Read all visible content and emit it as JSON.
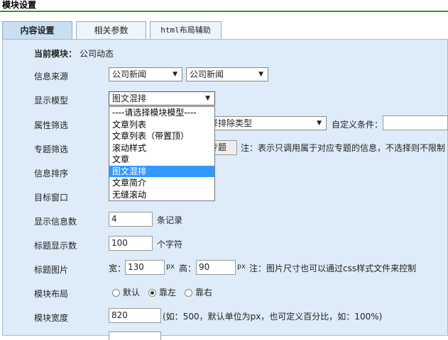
{
  "page_title": "模块设置",
  "tabs": [
    {
      "label": "内容设置",
      "active": true
    },
    {
      "label": "相关参数",
      "active": false
    },
    {
      "label": "html布局辅助",
      "active": false
    }
  ],
  "current_module": {
    "label": "当前模块：",
    "value": "公司动态"
  },
  "info_source": {
    "label": "信息来源",
    "select1": "公司新闻",
    "select2": "公司新闻"
  },
  "display_model": {
    "label": "显示模型",
    "selected": "图文混排",
    "options": [
      "----请选择模块模型----",
      "文章列表",
      "文章列表（带置顶）",
      "滚动样式",
      "文章",
      "图文混排",
      "文章简介",
      "无缝滚动"
    ],
    "selected_index": 5
  },
  "attr_filter": {
    "label": "属性筛选",
    "select_text": "择排除类型",
    "custom_label": "自定义条件："
  },
  "topic_filter": {
    "label": "专题筛选",
    "button_tail": "专题",
    "note": "注：表示只调用属于对应专题的信息，不选择则不限制"
  },
  "info_sort": {
    "label": "信息排序"
  },
  "target_window": {
    "label": "目标窗口"
  },
  "display_count": {
    "label": "显示信息数",
    "value": "4",
    "unit": "条记录"
  },
  "title_chars": {
    "label": "标题显示数",
    "value": "100",
    "unit": "个字符"
  },
  "title_image": {
    "label": "标题图片",
    "width_label": "宽：",
    "width": "130",
    "px1": "px",
    "height_label": "高：",
    "height": "90",
    "px2": "px",
    "note": "注：图片尺寸也可以通过css样式文件来控制"
  },
  "module_layout": {
    "label": "模块布局",
    "options": [
      "默认",
      "靠左",
      "靠右"
    ],
    "selected_index": 1
  },
  "module_width": {
    "label": "模块宽度",
    "value": "820",
    "note": "(如：500，默认单位为px，也可定义百分比，如：100%)"
  }
}
